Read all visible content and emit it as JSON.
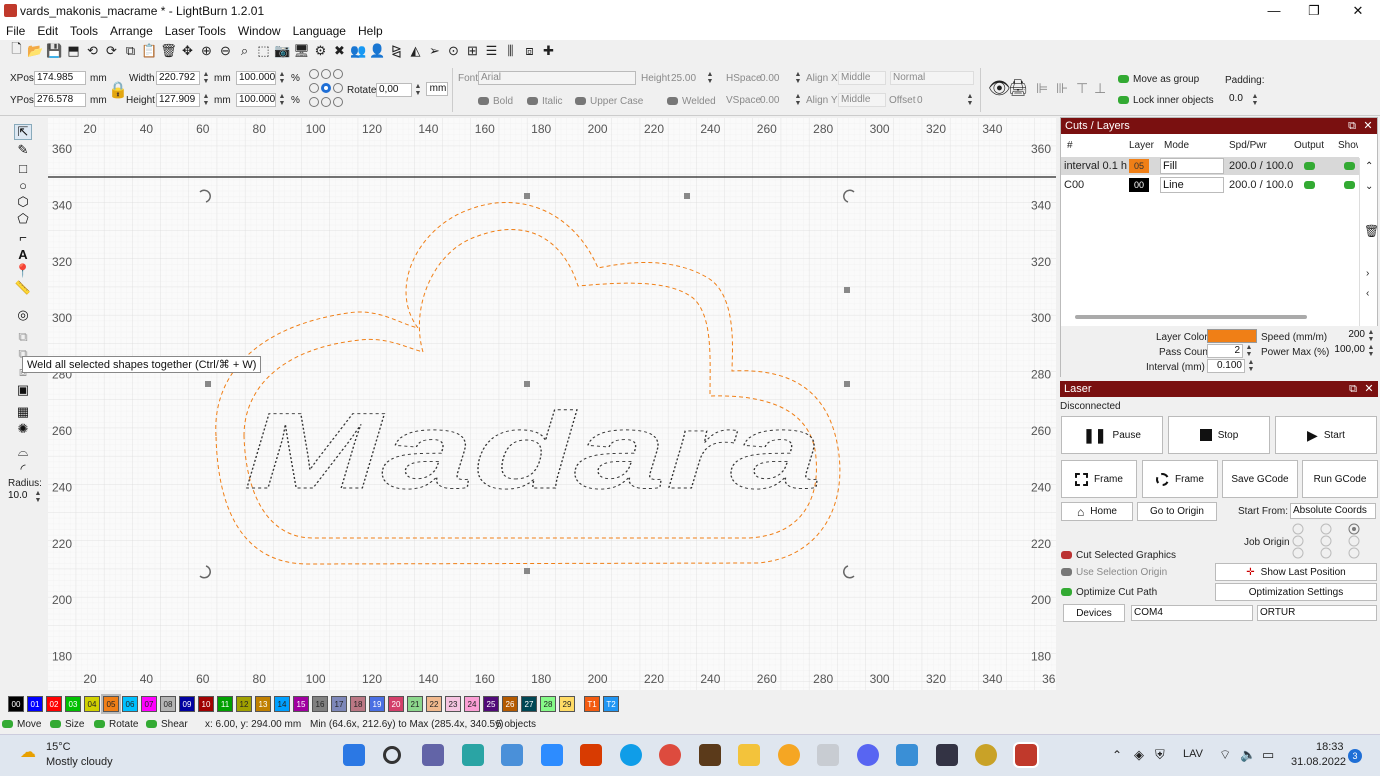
{
  "window": {
    "title": "vards_makonis_macrame * - LightBurn 1.2.01",
    "controls": {
      "minimize": "—",
      "maximize": "❐",
      "close": "✕"
    }
  },
  "menu": [
    "File",
    "Edit",
    "Tools",
    "Arrange",
    "Laser Tools",
    "Window",
    "Language",
    "Help"
  ],
  "props": {
    "xpos_label": "XPos",
    "xpos": "174.985",
    "ypos_label": "YPos",
    "ypos": "276.578",
    "unit": "mm",
    "width_label": "Width",
    "width": "220.792",
    "height_label": "Height",
    "height": "127.909",
    "scale_w": "100.000",
    "scale_h": "100.000",
    "percent": "%",
    "rotate_label": "Rotate",
    "rotate": "0,00",
    "rotate_unit": "mm",
    "font_label": "Font",
    "font": "Arial",
    "text_height_label": "Height",
    "text_height": "25.00",
    "hspace_label": "HSpace",
    "hspace": "0.00",
    "vspace_label": "VSpace",
    "vspace": "0.00",
    "alignx_label": "Align X",
    "alignx": "Middle",
    "aligny_label": "Align Y",
    "aligny": "Middle",
    "normal": "Normal",
    "offset_label": "Offset",
    "offset": "0",
    "bold": "Bold",
    "italic": "Italic",
    "upper": "Upper Case",
    "welded": "Welded",
    "move_group": "Move as group",
    "lock_inner": "Lock inner objects",
    "padding_label": "Padding:",
    "padding": "0.0"
  },
  "tooltip": "Weld all selected shapes together (Ctrl/⌘ + W)",
  "left_radius_label": "Radius:",
  "left_radius": "10.0",
  "ruler": {
    "x": [
      "20",
      "40",
      "60",
      "80",
      "100",
      "120",
      "140",
      "160",
      "180",
      "200",
      "220",
      "240",
      "260",
      "280",
      "300",
      "320",
      "340"
    ],
    "x_bottom": [
      "20",
      "40",
      "60",
      "80",
      "100",
      "120",
      "140",
      "160",
      "180",
      "200",
      "220",
      "240",
      "260",
      "280",
      "300",
      "320",
      "340",
      "36"
    ],
    "y": [
      "360",
      "340",
      "320",
      "300",
      "280",
      "260",
      "240",
      "220",
      "200",
      "180"
    ]
  },
  "canvas_text": "Madara",
  "cuts": {
    "title": "Cuts / Layers",
    "headers": [
      "#",
      "Layer",
      "Mode",
      "Spd/Pwr",
      "Output",
      "Show"
    ],
    "rows": [
      {
        "name": "interval 0.1 h",
        "layer": "05",
        "color": "#f07f16",
        "mode": "Fill",
        "spdpwr": "200.0 / 100.0"
      },
      {
        "name": "C00",
        "layer": "00",
        "color": "#000000",
        "mode": "Line",
        "spdpwr": "200.0 / 100.0"
      }
    ],
    "layer_color_label": "Layer Color",
    "layer_color": "#f07f16",
    "speed_label": "Speed (mm/m)",
    "speed": "200",
    "pass_label": "Pass Count",
    "pass": "2",
    "power_label": "Power Max (%)",
    "power": "100,00",
    "interval_label": "Interval (mm)",
    "interval": "0.100"
  },
  "laser": {
    "title": "Laser",
    "status": "Disconnected",
    "pause": "Pause",
    "stop": "Stop",
    "start": "Start",
    "frame1": "Frame",
    "frame2": "Frame",
    "save_gcode": "Save GCode",
    "run_gcode": "Run GCode",
    "home": "Home",
    "go_origin": "Go to Origin",
    "start_from_label": "Start From:",
    "start_from": "Absolute Coords",
    "job_origin_label": "Job Origin",
    "cut_selected": "Cut Selected Graphics",
    "use_sel_origin": "Use Selection Origin",
    "optimize": "Optimize Cut Path",
    "show_last": "Show Last Position",
    "opt_settings": "Optimization Settings",
    "devices": "Devices",
    "port": "COM4",
    "device": "ORTUR"
  },
  "palette": [
    {
      "l": "00",
      "c": "#000000"
    },
    {
      "l": "01",
      "c": "#0000ff"
    },
    {
      "l": "02",
      "c": "#ff0000"
    },
    {
      "l": "03",
      "c": "#00c000"
    },
    {
      "l": "04",
      "c": "#d0d000"
    },
    {
      "l": "05",
      "c": "#f07f16"
    },
    {
      "l": "06",
      "c": "#00c0ff"
    },
    {
      "l": "07",
      "c": "#ff00ff"
    },
    {
      "l": "08",
      "c": "#b4b4b4"
    },
    {
      "l": "09",
      "c": "#0000a0"
    },
    {
      "l": "10",
      "c": "#a00000"
    },
    {
      "l": "11",
      "c": "#00a000"
    },
    {
      "l": "12",
      "c": "#a0a000"
    },
    {
      "l": "13",
      "c": "#c08000"
    },
    {
      "l": "14",
      "c": "#00a0ff"
    },
    {
      "l": "15",
      "c": "#a000a0"
    },
    {
      "l": "16",
      "c": "#808080"
    },
    {
      "l": "17",
      "c": "#7d87b9"
    },
    {
      "l": "18",
      "c": "#bb7784"
    },
    {
      "l": "19",
      "c": "#4a6fe3"
    },
    {
      "l": "20",
      "c": "#d33f6a"
    },
    {
      "l": "21",
      "c": "#8cd78c"
    },
    {
      "l": "22",
      "c": "#f0b98d"
    },
    {
      "l": "23",
      "c": "#f6c4e1"
    },
    {
      "l": "24",
      "c": "#fa9ed4"
    },
    {
      "l": "25",
      "c": "#500a78"
    },
    {
      "l": "26",
      "c": "#b45a00"
    },
    {
      "l": "27",
      "c": "#004754"
    },
    {
      "l": "28",
      "c": "#86fa88"
    },
    {
      "l": "29",
      "c": "#ffdb66"
    },
    {
      "l": "T1",
      "c": "#f35b10"
    },
    {
      "l": "T2",
      "c": "#2196f3"
    }
  ],
  "status": {
    "move": "Move",
    "size": "Size",
    "rotate": "Rotate",
    "shear": "Shear",
    "coords": "x: 6.00, y: 294.00 mm",
    "bounds": "Min (64.6x, 212.6y) to Max (285.4x, 340.5y)",
    "objects": "5 objects"
  },
  "taskbar": {
    "temp": "15°C",
    "weather": "Mostly cloudy",
    "lang": "LAV",
    "time": "18:33",
    "date": "31.08.2022",
    "notif": "3"
  }
}
